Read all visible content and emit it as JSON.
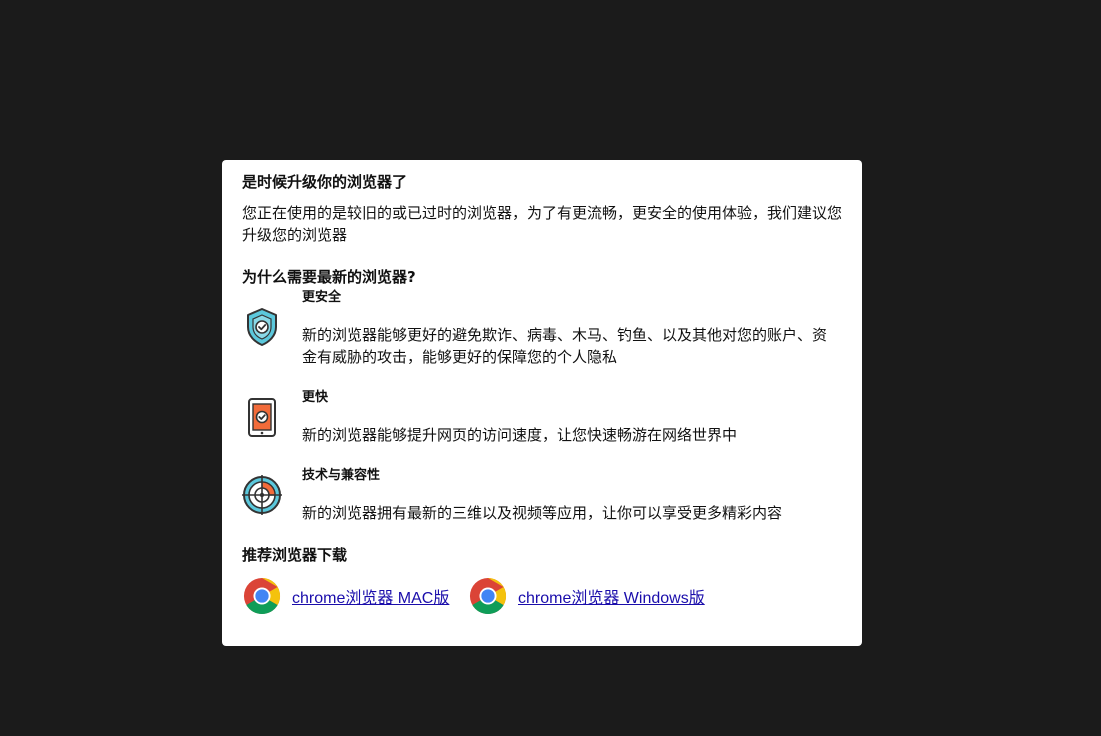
{
  "dialog": {
    "title": "是时候升级你的浏览器了",
    "intro": "您正在使用的是较旧的或已过时的浏览器，为了有更流畅，更安全的使用体验，我们建议您升级您的浏览器",
    "why_title": "为什么需要最新的浏览器?",
    "features": [
      {
        "icon": "shield-check-icon",
        "title": "更安全",
        "desc": "新的浏览器能够更好的避免欺诈、病毒、木马、钓鱼、以及其他对您的账户、资金有威胁的攻击，能够更好的保障您的个人隐私"
      },
      {
        "icon": "tablet-check-icon",
        "title": "更快",
        "desc": "新的浏览器能够提升网页的访问速度，让您快速畅游在网络世界中"
      },
      {
        "icon": "target-icon",
        "title": "技术与兼容性",
        "desc": "新的浏览器拥有最新的三维以及视频等应用，让你可以享受更多精彩内容"
      }
    ],
    "recommend_title": "推荐浏览器下载",
    "downloads": [
      {
        "icon": "chrome-icon",
        "label": "chrome浏览器 MAC版"
      },
      {
        "icon": "chrome-icon",
        "label": "chrome浏览器 Windows版"
      }
    ]
  },
  "colors": {
    "backdrop": "#1b1b1b",
    "dialog_bg": "#ffffff",
    "link": "#1a0dab",
    "shield": "#5bc8dc",
    "tablet_screen": "#f26b3a",
    "target_ring": "#5bc8dc",
    "target_accent": "#f26b3a"
  }
}
